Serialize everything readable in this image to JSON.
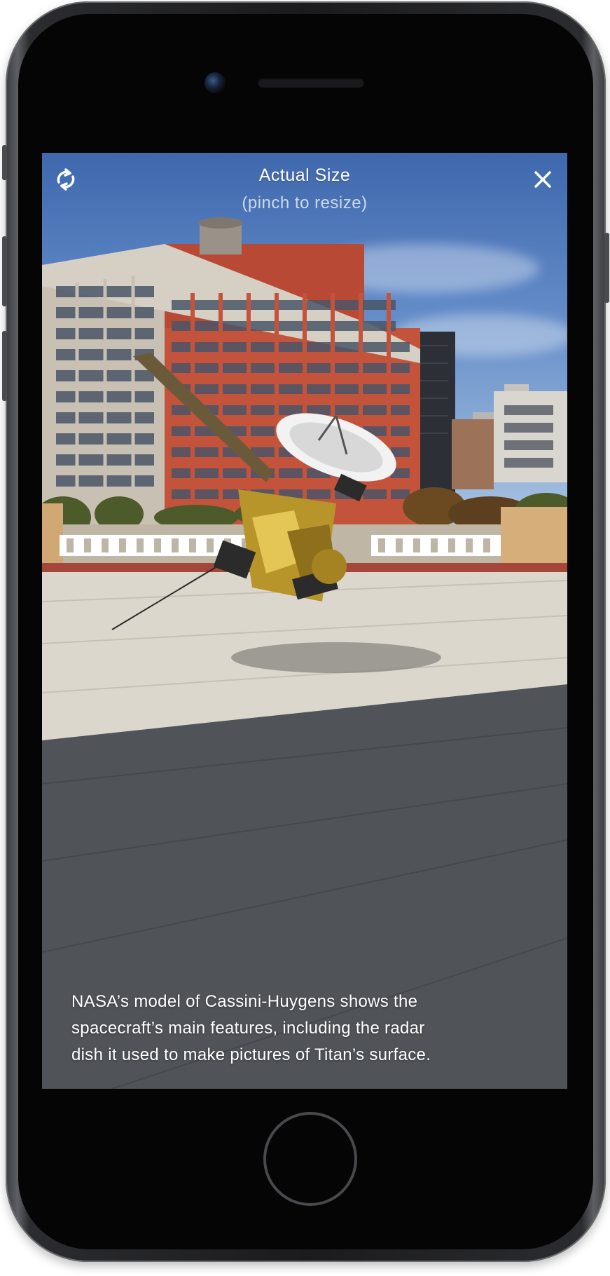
{
  "ar_view": {
    "title": "Actual Size",
    "subtitle": "(pinch to resize)",
    "rotate_icon": "rotate-arrows-icon",
    "close_icon": "close-x-icon",
    "caption_lines": [
      "NASA’s model of Cassini-Huygens shows the",
      "spacecraft’s main features, including the radar",
      "dish it used to make pictures of Titan’s surface."
    ]
  },
  "colors": {
    "overlay_text": "#ffffff",
    "phone_frame": "#1b1b1d",
    "sky": "#5f88c6",
    "brick": "#b84a35",
    "spacecraft_gold": "#b8952a"
  }
}
